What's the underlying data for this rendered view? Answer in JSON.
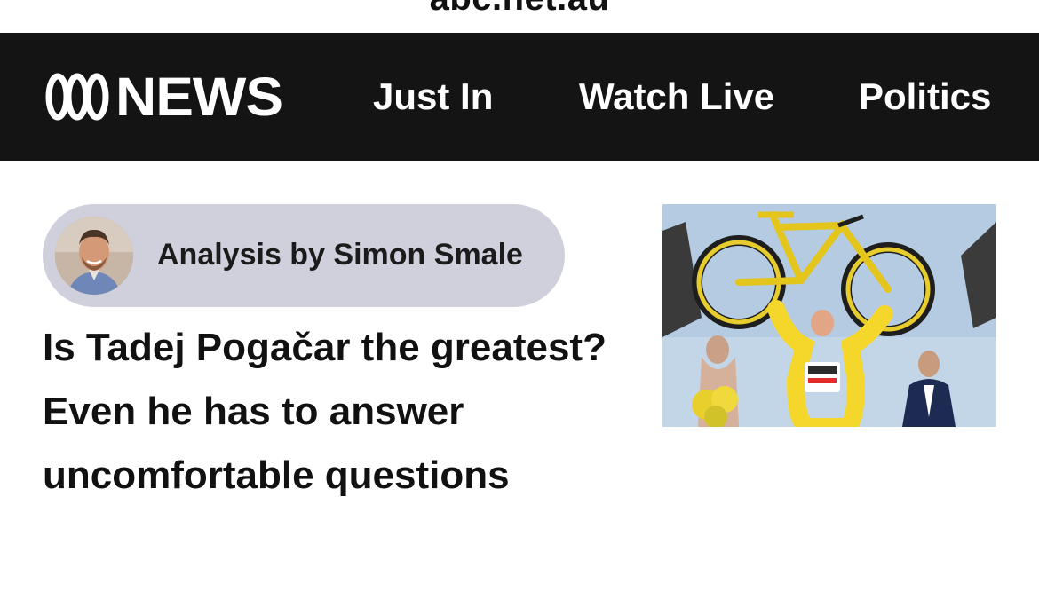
{
  "browser": {
    "url": "abc.net.au"
  },
  "header": {
    "logo_text": "NEWS",
    "nav": [
      {
        "label": "Just In"
      },
      {
        "label": "Watch Live"
      },
      {
        "label": "Politics"
      }
    ]
  },
  "article": {
    "byline": "Analysis by Simon Smale",
    "headline": "Is Tadej Pogačar the greatest? Even he has to answer uncomfortable questions"
  },
  "colors": {
    "navbar_bg": "#141414",
    "pill_bg": "#cfd0dc",
    "jersey_yellow": "#f5d62b"
  },
  "icons": [
    "abc-logo-icon",
    "author-avatar",
    "hero-photo"
  ]
}
